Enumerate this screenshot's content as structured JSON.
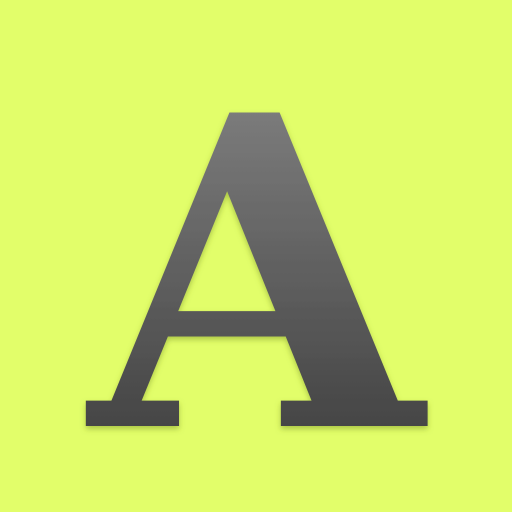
{
  "icon": {
    "letter": "A",
    "background_color": "#e2fe6a",
    "glyph_gradient_top": "#8a8a8a",
    "glyph_gradient_bottom": "#343434",
    "shadow_color": "#7f9a2a"
  }
}
